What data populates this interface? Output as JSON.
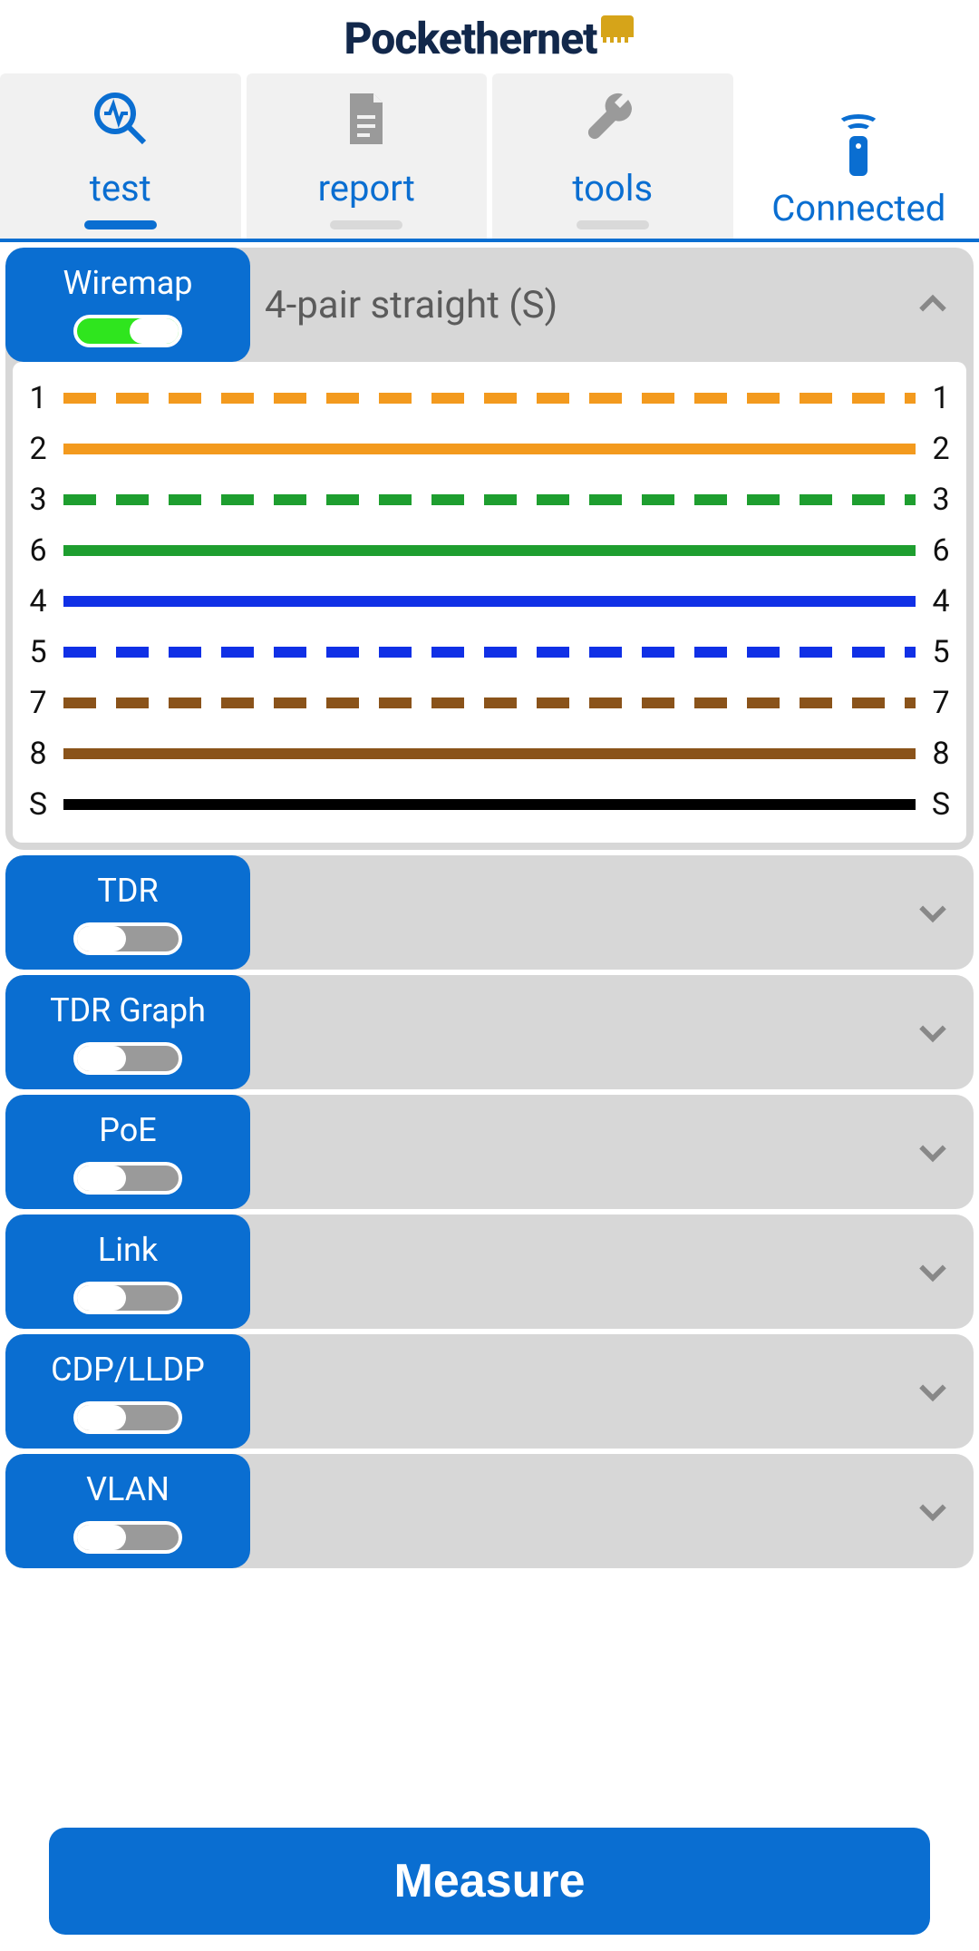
{
  "brand": {
    "name": "Pockethernet"
  },
  "tabs": {
    "items": [
      {
        "id": "test",
        "label": "test",
        "active": true
      },
      {
        "id": "report",
        "label": "report",
        "active": false
      },
      {
        "id": "tools",
        "label": "tools",
        "active": false
      }
    ],
    "status_label": "Connected"
  },
  "sections": [
    {
      "id": "wiremap",
      "title": "Wiremap",
      "enabled": true,
      "expanded": true,
      "summary": "4-pair straight (S)",
      "wiremap": {
        "pins_left": [
          "1",
          "2",
          "3",
          "6",
          "4",
          "5",
          "7",
          "8",
          "S"
        ],
        "pins_right": [
          "1",
          "2",
          "3",
          "6",
          "4",
          "5",
          "7",
          "8",
          "S"
        ],
        "wires": [
          {
            "color": "#f39a1e",
            "style": "dashed"
          },
          {
            "color": "#f39a1e",
            "style": "solid"
          },
          {
            "color": "#1e9e2f",
            "style": "dashed"
          },
          {
            "color": "#1e9e2f",
            "style": "solid"
          },
          {
            "color": "#1030e6",
            "style": "solid"
          },
          {
            "color": "#1030e6",
            "style": "dashed"
          },
          {
            "color": "#8a531a",
            "style": "dashed"
          },
          {
            "color": "#8a531a",
            "style": "solid"
          },
          {
            "color": "#000000",
            "style": "solid"
          }
        ]
      }
    },
    {
      "id": "tdr",
      "title": "TDR",
      "enabled": false,
      "expanded": false,
      "summary": ""
    },
    {
      "id": "tdr_graph",
      "title": "TDR Graph",
      "enabled": false,
      "expanded": false,
      "summary": ""
    },
    {
      "id": "poe",
      "title": "PoE",
      "enabled": false,
      "expanded": false,
      "summary": ""
    },
    {
      "id": "link",
      "title": "Link",
      "enabled": false,
      "expanded": false,
      "summary": ""
    },
    {
      "id": "cdp_lldp",
      "title": "CDP/LLDP",
      "enabled": false,
      "expanded": false,
      "summary": ""
    },
    {
      "id": "vlan",
      "title": "VLAN",
      "enabled": false,
      "expanded": false,
      "summary": ""
    }
  ],
  "measure_button": "Measure",
  "colors": {
    "primary": "#0a6ed1",
    "section_bg": "#d7d7d7",
    "toggle_on": "#2fe51e"
  }
}
